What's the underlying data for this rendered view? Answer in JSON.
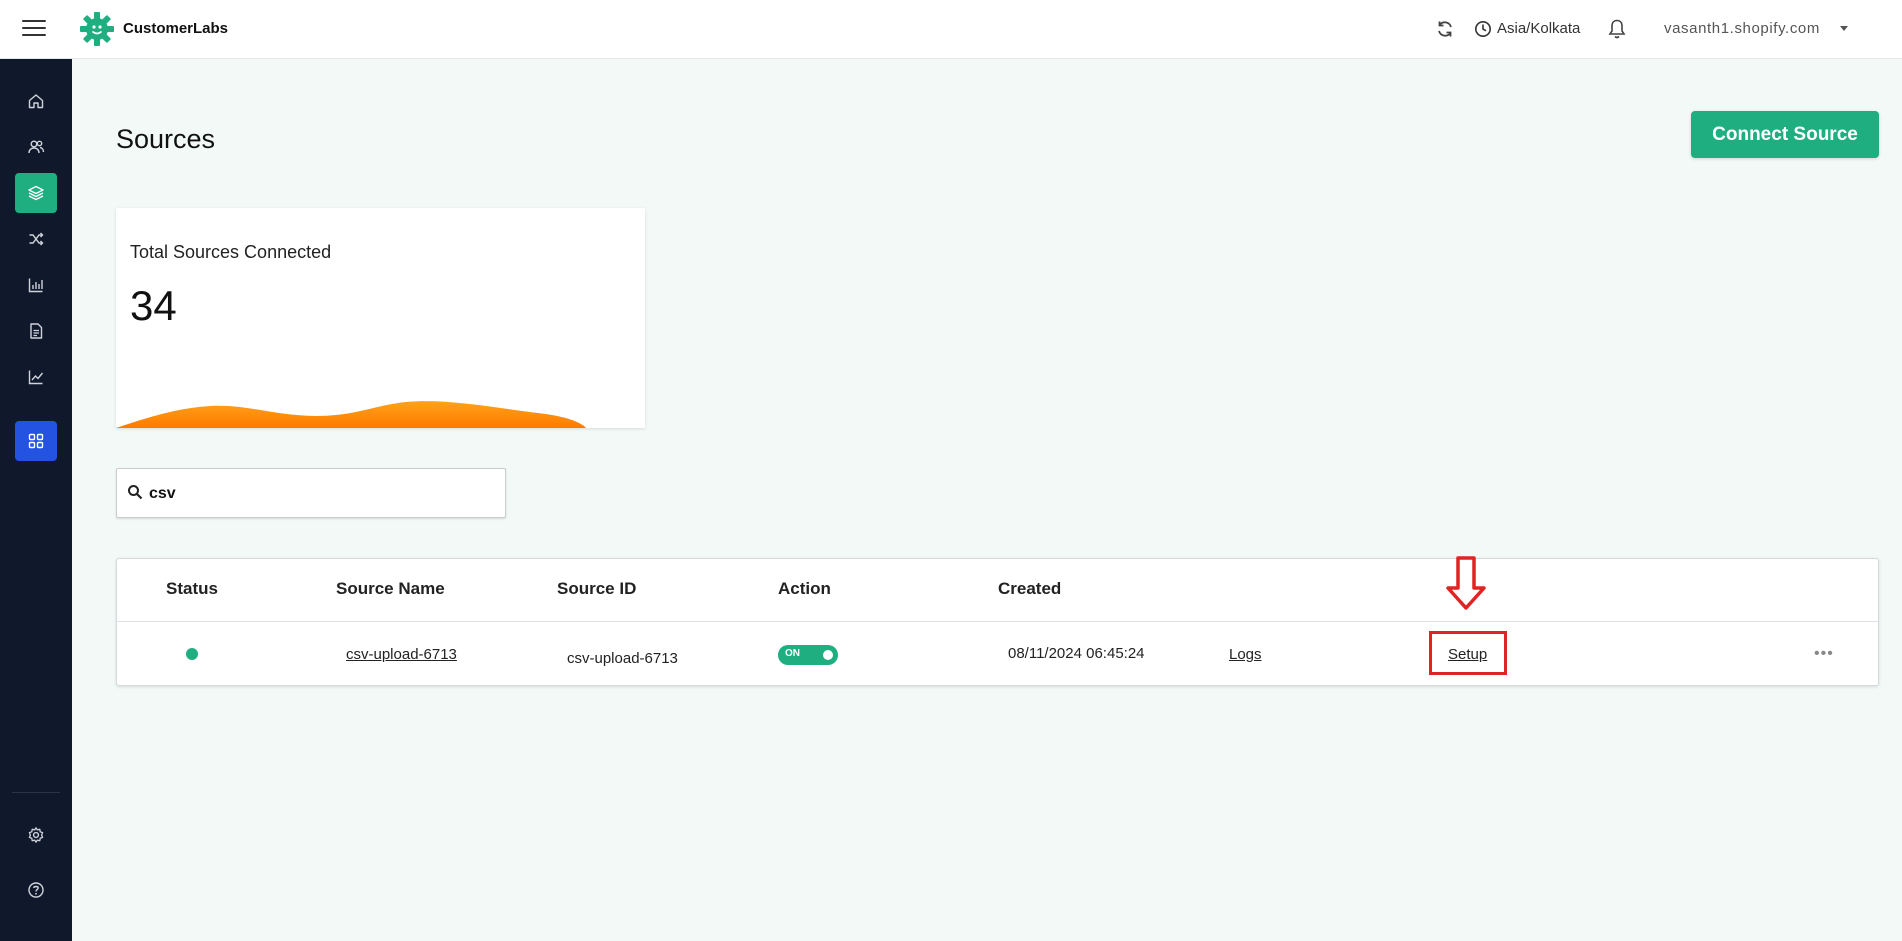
{
  "app": {
    "brand": "CustomerLabs",
    "timezone": "Asia/Kolkata",
    "account": "vasanth1.shopify.com"
  },
  "sidebar": {
    "items": [
      {
        "name": "home",
        "icon": "home-icon",
        "state": "normal"
      },
      {
        "name": "users",
        "icon": "users-icon",
        "state": "normal"
      },
      {
        "name": "sources",
        "icon": "layers-icon",
        "state": "active"
      },
      {
        "name": "shuffle",
        "icon": "shuffle-icon",
        "state": "normal"
      },
      {
        "name": "analytics",
        "icon": "bar-chart-icon",
        "state": "normal"
      },
      {
        "name": "reports",
        "icon": "document-icon",
        "state": "normal"
      },
      {
        "name": "trends",
        "icon": "line-chart-icon",
        "state": "normal"
      },
      {
        "name": "apps",
        "icon": "grid-icon",
        "state": "active-blue"
      }
    ],
    "bottom": [
      {
        "name": "settings",
        "icon": "gear-icon"
      },
      {
        "name": "help",
        "icon": "help-icon"
      }
    ]
  },
  "page": {
    "title": "Sources",
    "connect_button": "Connect Source"
  },
  "stat": {
    "label": "Total Sources Connected",
    "value": "34"
  },
  "search": {
    "value": "csv"
  },
  "table": {
    "headers": {
      "status": "Status",
      "source_name": "Source Name",
      "source_id": "Source ID",
      "action": "Action",
      "created": "Created"
    },
    "rows": [
      {
        "status": "active",
        "source_name": "csv-upload-6713",
        "source_id": "csv-upload-6713",
        "action_toggle": "ON",
        "created": "08/11/2024 06:45:24",
        "logs": "Logs",
        "setup": "Setup",
        "more": "•••"
      }
    ]
  },
  "colors": {
    "accent": "#1fae7f",
    "sidebar_bg": "#10192b",
    "active_blue": "#2353e0",
    "highlight_red": "#e02424",
    "wave_orange": "#ff8a00"
  }
}
